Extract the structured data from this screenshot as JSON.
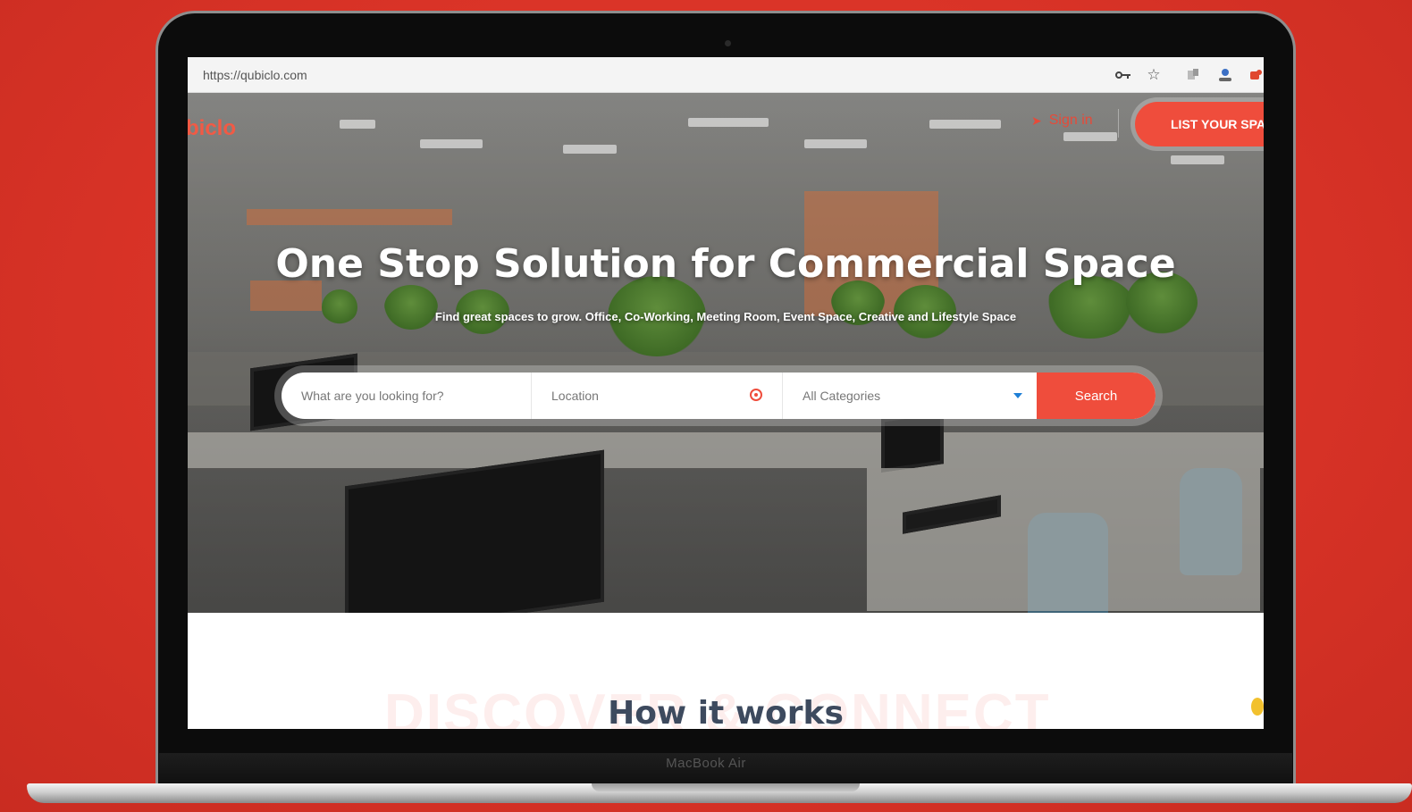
{
  "device": {
    "label": "MacBook Air"
  },
  "browser": {
    "url": "https://qubiclo.com",
    "icons": [
      "key-icon",
      "star-icon",
      "extension-icon",
      "profile-icon",
      "puzzle-icon"
    ]
  },
  "header": {
    "logo": "biclo",
    "sign_in": "Sign in",
    "list_space": "LIST YOUR SPA"
  },
  "hero": {
    "title": "One Stop Solution for Commercial Space",
    "subtitle": "Find great spaces to grow. Office, Co-Working, Meeting Room, Event Space, Creative and Lifestyle Space"
  },
  "search": {
    "keyword_placeholder": "What are you looking for?",
    "location_placeholder": "Location",
    "category_selected": "All Categories",
    "button": "Search"
  },
  "how_it_works": {
    "background_text": "DISCOVER & CONNECT",
    "title": "How it works"
  },
  "colors": {
    "background": "#d93327",
    "accent": "#ef4d3c",
    "heading": "#3d4a5e"
  }
}
